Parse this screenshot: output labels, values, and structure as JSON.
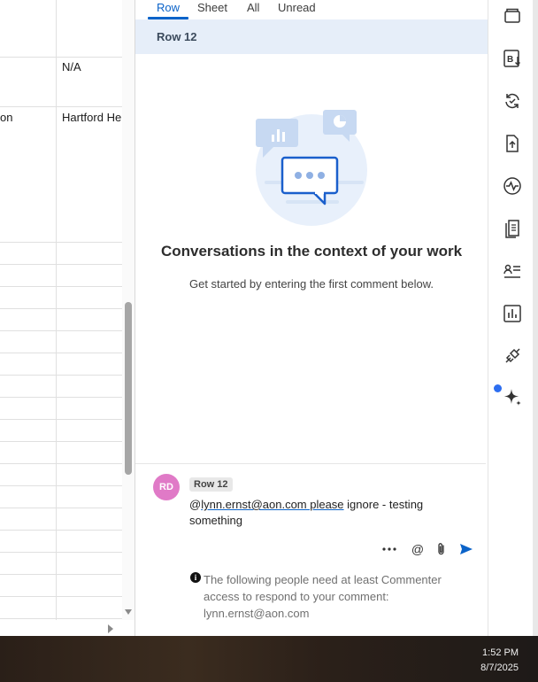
{
  "sheet": {
    "cells": [
      {
        "text": "N/A"
      },
      {
        "text": "on"
      },
      {
        "text": "Hartford He"
      }
    ]
  },
  "panel": {
    "tabs": [
      {
        "label": "Row"
      },
      {
        "label": "Sheet"
      },
      {
        "label": "All"
      },
      {
        "label": "Unread"
      }
    ],
    "row_header": "Row 12",
    "empty_title": "Conversations in the context of your work",
    "empty_subtitle": "Get started by entering the first comment below.",
    "composer": {
      "avatar_initials": "RD",
      "row_badge": "Row 12",
      "at_symbol": "@",
      "mention": "lynn.ernst@aon.com  please",
      "comment_rest": " ignore - testing something",
      "tools": {
        "more": "more-icon",
        "mention": "@",
        "attach": "paperclip-icon",
        "send": "send-icon"
      }
    },
    "notice": {
      "icon": "i",
      "text": "The following people need at least Commenter access to respond to your comment: lynn.ernst@aon.com"
    }
  },
  "rail": {
    "icons": [
      "wallet-icon",
      "bold-sort-icon",
      "sync-icon",
      "upload-file-icon",
      "activity-icon",
      "document-icon",
      "contacts-icon",
      "bar-chart-icon",
      "connector-icon",
      "sparkle-icon"
    ],
    "accent": "#2d6ef0"
  },
  "taskbar": {
    "time": "1:52 PM",
    "date": "8/7/2025"
  },
  "colors": {
    "accent": "#0b63c9",
    "row_header_bg": "#e6eef9",
    "avatar_bg": "#e07ac7"
  }
}
